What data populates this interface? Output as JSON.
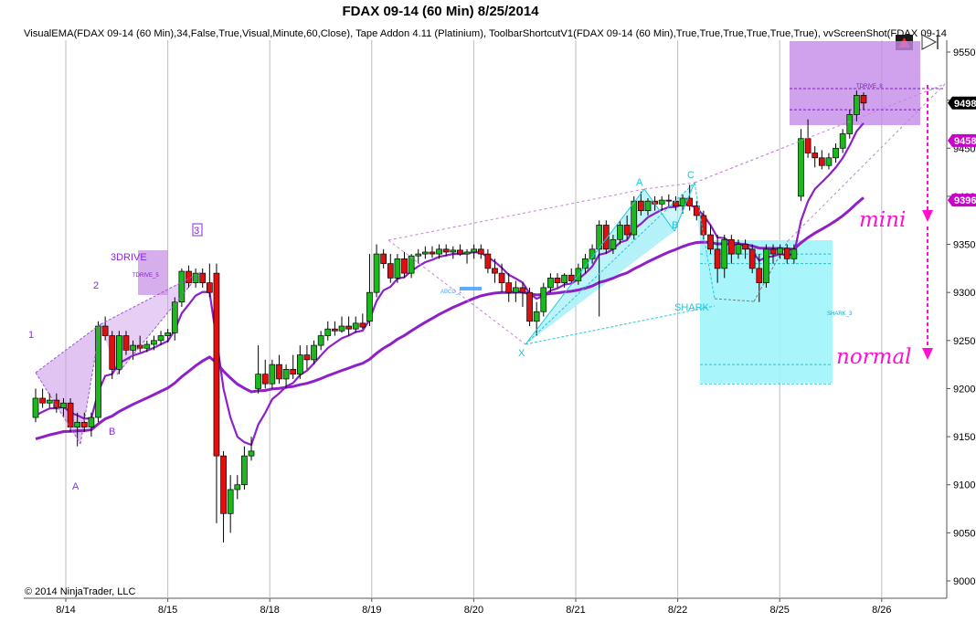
{
  "chart_data": {
    "type": "candlestick",
    "title": "FDAX 09-14 (60 Min)  8/25/2014",
    "indicator_line": "VisualEMA(FDAX 09-14 (60 Min),34,False,True,Visual,Minute,60,Close), Tape Addon 4.11 (Platinium), ToolbarShortcutV1(FDAX 09-14 (60 Min),True,True,True,True,True,True), vvScreenShot(FDAX 09-14",
    "copyright": "© 2014 NinjaTrader, LLC",
    "x_tick_labels": [
      "8/14",
      "8/15",
      "8/18",
      "8/19",
      "8/20",
      "8/21",
      "8/22",
      "8/25",
      "8/26"
    ],
    "y_tick_labels": [
      "9550",
      "9500",
      "9450",
      "9400",
      "9350",
      "9300",
      "9250",
      "9200",
      "9150",
      "9100",
      "9050",
      "9000"
    ],
    "ylim": [
      8980,
      9570
    ],
    "price_tags": [
      {
        "text": "9498",
        "value": 9497,
        "color": "#000000"
      },
      {
        "text": "9458",
        "value": 9458,
        "color": "#cc00cc"
      },
      {
        "text": "9396",
        "value": 9396,
        "color": "#cc00cc"
      }
    ],
    "pattern_labels": [
      {
        "text": "1",
        "color": "#8a2be2"
      },
      {
        "text": "2",
        "color": "#8a2be2"
      },
      {
        "text": "3DRIVE",
        "color": "#8a2be2"
      },
      {
        "text": "3",
        "color": "#8a2be2"
      },
      {
        "text": "A",
        "color": "#8a2be2"
      },
      {
        "text": "B",
        "color": "#8a2be2"
      },
      {
        "text": "A",
        "color": "#18c8e0"
      },
      {
        "text": "C",
        "color": "#18c8e0"
      },
      {
        "text": "B",
        "color": "#18c8e0"
      },
      {
        "text": "X",
        "color": "#18c8e0"
      },
      {
        "text": "SHARK",
        "color": "#18c8e0"
      }
    ],
    "box_labels": [
      "TDRIVE_5",
      "TDRIVE_8",
      "ABCD_1",
      "SHARK_3"
    ],
    "annotations": [
      "mini",
      "normal"
    ],
    "candles": [
      {
        "o": 9170,
        "h": 9200,
        "l": 9165,
        "c": 9190
      },
      {
        "o": 9190,
        "h": 9200,
        "l": 9180,
        "c": 9185
      },
      {
        "o": 9185,
        "h": 9195,
        "l": 9180,
        "c": 9188
      },
      {
        "o": 9188,
        "h": 9195,
        "l": 9175,
        "c": 9180
      },
      {
        "o": 9180,
        "h": 9190,
        "l": 9170,
        "c": 9185
      },
      {
        "o": 9185,
        "h": 9190,
        "l": 9155,
        "c": 9160
      },
      {
        "o": 9160,
        "h": 9175,
        "l": 9140,
        "c": 9165
      },
      {
        "o": 9165,
        "h": 9175,
        "l": 9155,
        "c": 9160
      },
      {
        "o": 9160,
        "h": 9175,
        "l": 9150,
        "c": 9170
      },
      {
        "o": 9170,
        "h": 9270,
        "l": 9165,
        "c": 9265
      },
      {
        "o": 9265,
        "h": 9275,
        "l": 9250,
        "c": 9255
      },
      {
        "o": 9255,
        "h": 9260,
        "l": 9210,
        "c": 9220
      },
      {
        "o": 9220,
        "h": 9260,
        "l": 9215,
        "c": 9255
      },
      {
        "o": 9255,
        "h": 9260,
        "l": 9235,
        "c": 9240
      },
      {
        "o": 9240,
        "h": 9250,
        "l": 9230,
        "c": 9245
      },
      {
        "o": 9245,
        "h": 9255,
        "l": 9238,
        "c": 9242
      },
      {
        "o": 9242,
        "h": 9250,
        "l": 9238,
        "c": 9246
      },
      {
        "o": 9246,
        "h": 9255,
        "l": 9240,
        "c": 9250
      },
      {
        "o": 9250,
        "h": 9260,
        "l": 9245,
        "c": 9255
      },
      {
        "o": 9255,
        "h": 9262,
        "l": 9248,
        "c": 9258
      },
      {
        "o": 9258,
        "h": 9295,
        "l": 9250,
        "c": 9290
      },
      {
        "o": 9290,
        "h": 9325,
        "l": 9285,
        "c": 9322
      },
      {
        "o": 9322,
        "h": 9328,
        "l": 9305,
        "c": 9310
      },
      {
        "o": 9310,
        "h": 9325,
        "l": 9305,
        "c": 9320
      },
      {
        "o": 9320,
        "h": 9325,
        "l": 9305,
        "c": 9310
      },
      {
        "o": 9310,
        "h": 9330,
        "l": 9295,
        "c": 9300
      },
      {
        "o": 9320,
        "h": 9330,
        "l": 9060,
        "c": 9130
      },
      {
        "o": 9130,
        "h": 9135,
        "l": 9040,
        "c": 9070
      },
      {
        "o": 9070,
        "h": 9110,
        "l": 9050,
        "c": 9095
      },
      {
        "o": 9095,
        "h": 9110,
        "l": 9085,
        "c": 9100
      },
      {
        "o": 9100,
        "h": 9140,
        "l": 9095,
        "c": 9130
      },
      {
        "o": 9130,
        "h": 9150,
        "l": 9125,
        "c": 9135
      },
      {
        "o": 9200,
        "h": 9245,
        "l": 9195,
        "c": 9215
      },
      {
        "o": 9215,
        "h": 9230,
        "l": 9200,
        "c": 9205
      },
      {
        "o": 9205,
        "h": 9230,
        "l": 9200,
        "c": 9225
      },
      {
        "o": 9225,
        "h": 9235,
        "l": 9205,
        "c": 9210
      },
      {
        "o": 9210,
        "h": 9225,
        "l": 9200,
        "c": 9220
      },
      {
        "o": 9220,
        "h": 9235,
        "l": 9210,
        "c": 9215
      },
      {
        "o": 9215,
        "h": 9245,
        "l": 9210,
        "c": 9235
      },
      {
        "o": 9235,
        "h": 9245,
        "l": 9220,
        "c": 9230
      },
      {
        "o": 9230,
        "h": 9250,
        "l": 9225,
        "c": 9245
      },
      {
        "o": 9245,
        "h": 9260,
        "l": 9240,
        "c": 9255
      },
      {
        "o": 9255,
        "h": 9270,
        "l": 9250,
        "c": 9262
      },
      {
        "o": 9262,
        "h": 9270,
        "l": 9255,
        "c": 9260
      },
      {
        "o": 9260,
        "h": 9275,
        "l": 9258,
        "c": 9265
      },
      {
        "o": 9265,
        "h": 9275,
        "l": 9255,
        "c": 9262
      },
      {
        "o": 9262,
        "h": 9275,
        "l": 9258,
        "c": 9268
      },
      {
        "o": 9268,
        "h": 9278,
        "l": 9262,
        "c": 9264
      },
      {
        "o": 9270,
        "h": 9340,
        "l": 9265,
        "c": 9300
      },
      {
        "o": 9300,
        "h": 9350,
        "l": 9295,
        "c": 9340
      },
      {
        "o": 9340,
        "h": 9345,
        "l": 9325,
        "c": 9330
      },
      {
        "o": 9330,
        "h": 9340,
        "l": 9310,
        "c": 9315
      },
      {
        "o": 9315,
        "h": 9340,
        "l": 9310,
        "c": 9335
      },
      {
        "o": 9335,
        "h": 9342,
        "l": 9315,
        "c": 9320
      },
      {
        "o": 9320,
        "h": 9340,
        "l": 9315,
        "c": 9338
      },
      {
        "o": 9338,
        "h": 9345,
        "l": 9330,
        "c": 9340
      },
      {
        "o": 9340,
        "h": 9348,
        "l": 9335,
        "c": 9342
      },
      {
        "o": 9342,
        "h": 9348,
        "l": 9336,
        "c": 9340
      },
      {
        "o": 9340,
        "h": 9350,
        "l": 9335,
        "c": 9345
      },
      {
        "o": 9345,
        "h": 9350,
        "l": 9338,
        "c": 9342
      },
      {
        "o": 9342,
        "h": 9348,
        "l": 9335,
        "c": 9344
      },
      {
        "o": 9344,
        "h": 9350,
        "l": 9338,
        "c": 9340
      },
      {
        "o": 9340,
        "h": 9345,
        "l": 9330,
        "c": 9342
      },
      {
        "o": 9342,
        "h": 9350,
        "l": 9335,
        "c": 9345
      },
      {
        "o": 9345,
        "h": 9350,
        "l": 9335,
        "c": 9340
      },
      {
        "o": 9340,
        "h": 9345,
        "l": 9320,
        "c": 9325
      },
      {
        "o": 9325,
        "h": 9335,
        "l": 9310,
        "c": 9320
      },
      {
        "o": 9320,
        "h": 9330,
        "l": 9300,
        "c": 9310
      },
      {
        "o": 9310,
        "h": 9320,
        "l": 9290,
        "c": 9300
      },
      {
        "o": 9300,
        "h": 9312,
        "l": 9290,
        "c": 9305
      },
      {
        "o": 9305,
        "h": 9310,
        "l": 9285,
        "c": 9300
      },
      {
        "o": 9300,
        "h": 9305,
        "l": 9265,
        "c": 9270
      },
      {
        "o": 9270,
        "h": 9290,
        "l": 9255,
        "c": 9280
      },
      {
        "o": 9280,
        "h": 9310,
        "l": 9275,
        "c": 9305
      },
      {
        "o": 9305,
        "h": 9320,
        "l": 9300,
        "c": 9315
      },
      {
        "o": 9315,
        "h": 9320,
        "l": 9305,
        "c": 9310
      },
      {
        "o": 9310,
        "h": 9320,
        "l": 9305,
        "c": 9318
      },
      {
        "o": 9318,
        "h": 9325,
        "l": 9310,
        "c": 9312
      },
      {
        "o": 9312,
        "h": 9330,
        "l": 9308,
        "c": 9325
      },
      {
        "o": 9325,
        "h": 9340,
        "l": 9320,
        "c": 9335
      },
      {
        "o": 9335,
        "h": 9350,
        "l": 9330,
        "c": 9345
      },
      {
        "o": 9345,
        "h": 9375,
        "l": 9275,
        "c": 9370
      },
      {
        "o": 9370,
        "h": 9375,
        "l": 9340,
        "c": 9345
      },
      {
        "o": 9345,
        "h": 9360,
        "l": 9340,
        "c": 9355
      },
      {
        "o": 9355,
        "h": 9375,
        "l": 9350,
        "c": 9370
      },
      {
        "o": 9370,
        "h": 9380,
        "l": 9355,
        "c": 9360
      },
      {
        "o": 9360,
        "h": 9400,
        "l": 9355,
        "c": 9395
      },
      {
        "o": 9395,
        "h": 9405,
        "l": 9380,
        "c": 9385
      },
      {
        "o": 9385,
        "h": 9398,
        "l": 9380,
        "c": 9395
      },
      {
        "o": 9395,
        "h": 9400,
        "l": 9385,
        "c": 9392
      },
      {
        "o": 9392,
        "h": 9400,
        "l": 9385,
        "c": 9396
      },
      {
        "o": 9396,
        "h": 9402,
        "l": 9388,
        "c": 9395
      },
      {
        "o": 9395,
        "h": 9400,
        "l": 9385,
        "c": 9390
      },
      {
        "o": 9390,
        "h": 9402,
        "l": 9382,
        "c": 9398
      },
      {
        "o": 9398,
        "h": 9412,
        "l": 9385,
        "c": 9390
      },
      {
        "o": 9390,
        "h": 9395,
        "l": 9375,
        "c": 9380
      },
      {
        "o": 9380,
        "h": 9385,
        "l": 9355,
        "c": 9360
      },
      {
        "o": 9360,
        "h": 9370,
        "l": 9340,
        "c": 9345
      },
      {
        "o": 9345,
        "h": 9360,
        "l": 9310,
        "c": 9325
      },
      {
        "o": 9325,
        "h": 9360,
        "l": 9315,
        "c": 9355
      },
      {
        "o": 9355,
        "h": 9360,
        "l": 9330,
        "c": 9340
      },
      {
        "o": 9340,
        "h": 9355,
        "l": 9335,
        "c": 9350
      },
      {
        "o": 9350,
        "h": 9355,
        "l": 9335,
        "c": 9345
      },
      {
        "o": 9345,
        "h": 9350,
        "l": 9320,
        "c": 9325
      },
      {
        "o": 9325,
        "h": 9340,
        "l": 9290,
        "c": 9310
      },
      {
        "o": 9310,
        "h": 9350,
        "l": 9305,
        "c": 9345
      },
      {
        "o": 9345,
        "h": 9350,
        "l": 9330,
        "c": 9340
      },
      {
        "o": 9340,
        "h": 9350,
        "l": 9335,
        "c": 9346
      },
      {
        "o": 9346,
        "h": 9350,
        "l": 9330,
        "c": 9335
      },
      {
        "o": 9335,
        "h": 9350,
        "l": 9330,
        "c": 9345
      },
      {
        "o": 9400,
        "h": 9470,
        "l": 9395,
        "c": 9460
      },
      {
        "o": 9460,
        "h": 9480,
        "l": 9440,
        "c": 9445
      },
      {
        "o": 9445,
        "h": 9452,
        "l": 9430,
        "c": 9440
      },
      {
        "o": 9440,
        "h": 9448,
        "l": 9428,
        "c": 9432
      },
      {
        "o": 9432,
        "h": 9445,
        "l": 9428,
        "c": 9440
      },
      {
        "o": 9440,
        "h": 9455,
        "l": 9435,
        "c": 9450
      },
      {
        "o": 9450,
        "h": 9470,
        "l": 9445,
        "c": 9465
      },
      {
        "o": 9465,
        "h": 9490,
        "l": 9460,
        "c": 9485
      },
      {
        "o": 9485,
        "h": 9510,
        "l": 9478,
        "c": 9505
      },
      {
        "o": 9505,
        "h": 9508,
        "l": 9490,
        "c": 9497
      }
    ],
    "grid": true
  }
}
